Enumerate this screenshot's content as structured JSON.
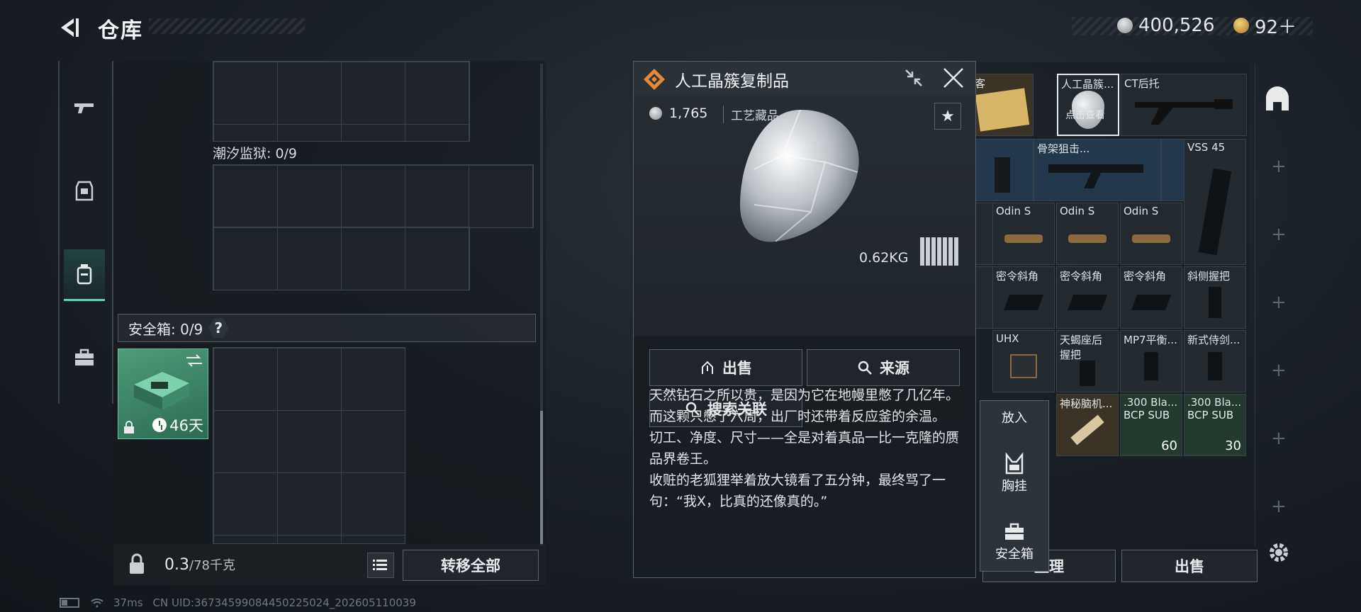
{
  "header": {
    "title": "仓库",
    "currency_main": "400,526",
    "currency_secondary": "92＋"
  },
  "left_nav": [
    "gun-icon",
    "armor-icon",
    "backpack-icon",
    "briefcase-icon"
  ],
  "storage": {
    "prison_label": "潮汐监狱: 0/9",
    "safe_label": "安全箱: 0/9",
    "safe_help": "?",
    "safe_days": "46天",
    "weight_value": "0.3",
    "weight_total": "/78千克",
    "transfer_all": "转移全部"
  },
  "status": {
    "ping": "37ms",
    "uid": "CN UID:3673459908445022502­4_202605110039"
  },
  "detail": {
    "title": "人工晶簇复制品",
    "price": "1,765",
    "category": "工艺藏品",
    "weight": "0.62KG",
    "actions": {
      "sell": "出售",
      "source": "来源",
      "search": "搜索关联"
    },
    "description": [
      "天然钻石之所以贵，是因为它在地幔里憋了几亿年。",
      "而这颗只憋了六周，出厂时还带着反应釜的余温。",
      "切工、净度、尺寸——全是对着真品一比一克隆的赝品界卷王。",
      "收赃的老狐狸举着放大镜看了五分钟，最终骂了一句：“我X，比真的还像真的。”"
    ],
    "accent": "#e58a3a"
  },
  "inventory": {
    "rows": [
      [
        "客",
        "人工晶簇...",
        "CT后托",
        ""
      ],
      [
        "",
        "骨架狙击...",
        "",
        "VSS 45"
      ],
      [
        "",
        "Odin S",
        "Odin S",
        "Odin S"
      ],
      [
        "",
        "密令斜角",
        "密令斜角",
        "密令斜角"
      ],
      [
        "UHX",
        "天蝎座后握把",
        "MP7平衡...",
        "新式侍剑..."
      ],
      [
        "",
        "神秘脑机...",
        ".300 Bla...",
        ".300 Bla..."
      ]
    ],
    "extra_labels": {
      "row3_col4": "斜侧握把",
      "blk_sub1": "BCP SUB",
      "blk_sub2": "BCP SUB",
      "overlay_text": "点击查看"
    },
    "counts": {
      "ammo1": "60",
      "ammo2": "30"
    },
    "buttons": {
      "arrange": "整理",
      "sell": "出售"
    }
  },
  "put_menu": {
    "title": "放入",
    "chest": "胸挂",
    "safe": "安全箱"
  }
}
